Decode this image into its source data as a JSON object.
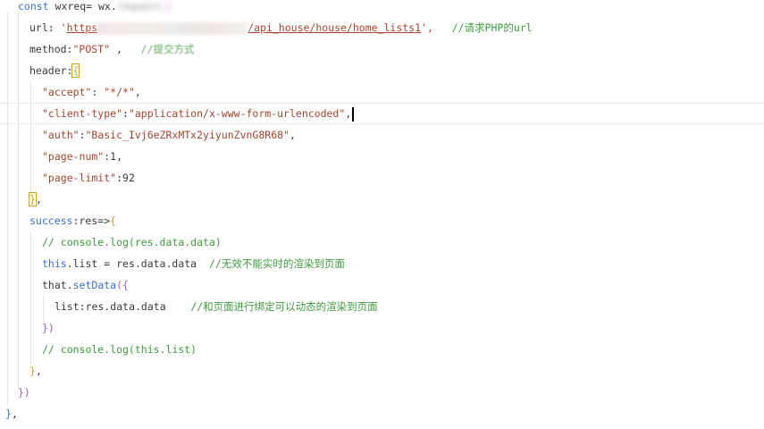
{
  "code": {
    "l1": {
      "const": "const",
      "var": " wxreq= wx.",
      "blurred": "request",
      "paren": "({"
    },
    "l2": {
      "key": "url: ",
      "q1": "'",
      "https": "https",
      "path": "/api_house/house/home_lists1",
      "q2": "',",
      "comment": "//请求PHP的url"
    },
    "l3": {
      "key": "method:",
      "value": "\"POST\"",
      "comma": " ,",
      "comment": "//提交方式"
    },
    "l4": {
      "key": "header:",
      "brace": "{"
    },
    "l5": {
      "key": "\"accept\"",
      "colon": ": ",
      "value": "\"*/*\"",
      "comma": ","
    },
    "l6": {
      "key": "\"client-type\"",
      "colon": ":",
      "value": "\"application/x-www-form-urlencoded\"",
      "comma": ","
    },
    "l7": {
      "key": "\"auth\"",
      "colon": ":",
      "value": "\"Basic_Ivj6eZRxMTx2yiyunZvnG8R68\"",
      "comma": ","
    },
    "l8": {
      "key": "\"page-num\"",
      "rest": ":1,"
    },
    "l9": {
      "key": "\"page-limit\"",
      "rest": ":92"
    },
    "l10": {
      "brace": "}",
      "comma": ","
    },
    "l11": {
      "key": "success",
      "rest": ":res=>",
      "brace": "{"
    },
    "l12": {
      "comment": "// console.log(res.data.data)"
    },
    "l13": {
      "this": "this",
      "rest": ".list = res.data.data",
      "comment": "//无效不能实时的渲染到页面"
    },
    "l14": {
      "that": "that.",
      "fn": "setData",
      "paren": "({"
    },
    "l15": {
      "rest": "list:res.data.data",
      "comment": "//和页面进行绑定可以动态的渲染到页面"
    },
    "l16": {
      "paren": "})"
    },
    "l17": {
      "comment": "// console.log(this.list)"
    },
    "l18": {
      "brace": "}",
      "comma": ","
    },
    "l19": {
      "paren": "})"
    },
    "l20": {
      "brace": "}",
      "comma": ","
    }
  },
  "colors": {
    "keyword": "#3b6fd8",
    "string": "#a6432f",
    "comment": "#3e9a3e",
    "bracket": "#c9a227"
  }
}
